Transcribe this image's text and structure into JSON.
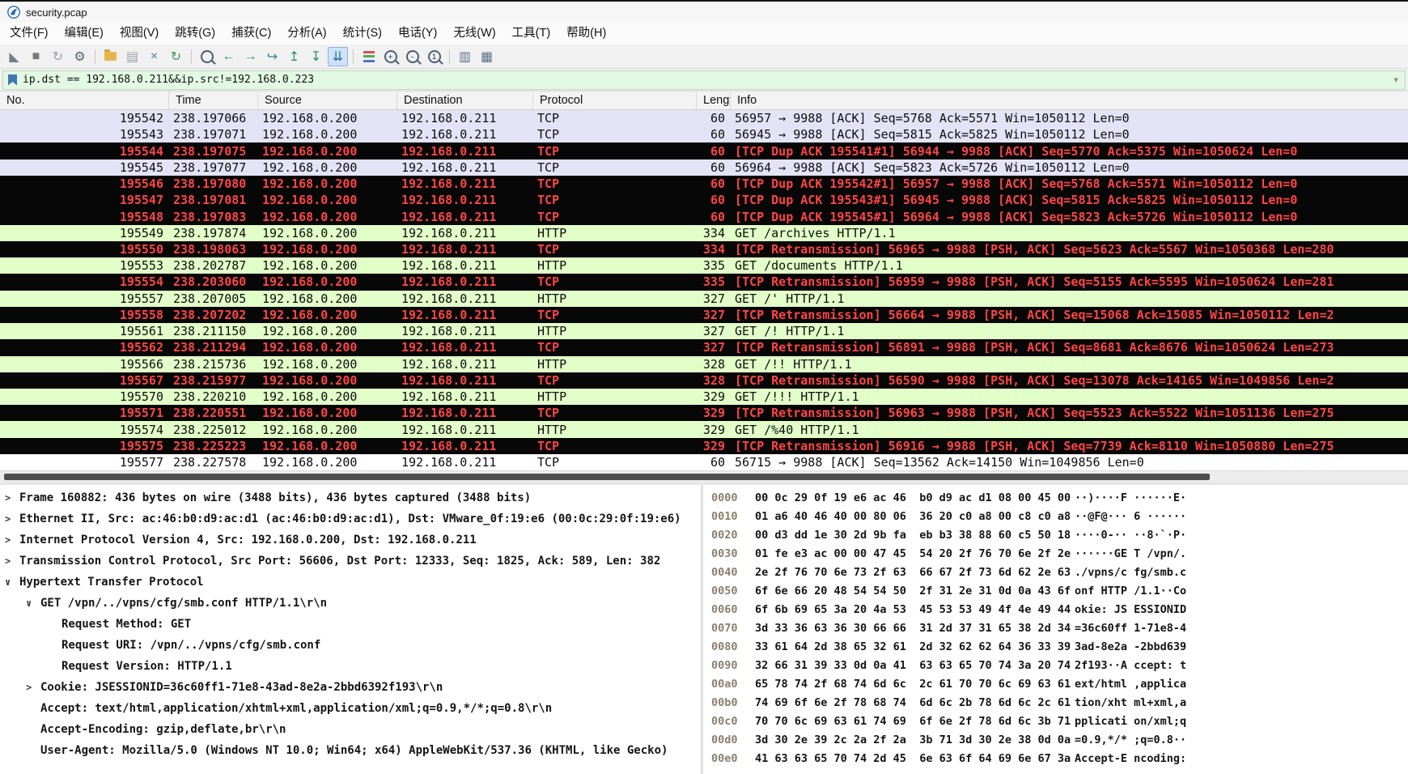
{
  "window": {
    "title": "security.pcap"
  },
  "menu": {
    "items": [
      {
        "id": "file",
        "label": "文件(F)"
      },
      {
        "id": "edit",
        "label": "编辑(E)"
      },
      {
        "id": "view",
        "label": "视图(V)"
      },
      {
        "id": "go",
        "label": "跳转(G)"
      },
      {
        "id": "capture",
        "label": "捕获(C)"
      },
      {
        "id": "analyze",
        "label": "分析(A)"
      },
      {
        "id": "statistics",
        "label": "统计(S)"
      },
      {
        "id": "telephony",
        "label": "电话(Y)"
      },
      {
        "id": "wireless",
        "label": "无线(W)"
      },
      {
        "id": "tools",
        "label": "工具(T)"
      },
      {
        "id": "help",
        "label": "帮助(H)"
      }
    ]
  },
  "toolbar": {
    "separators_after": [
      3,
      7,
      14,
      18
    ],
    "icons": [
      {
        "id": "start-capture",
        "kind": "glyph",
        "glyph": "◣",
        "color": "#6e7f8d"
      },
      {
        "id": "stop-capture",
        "kind": "glyph",
        "glyph": "■",
        "color": "#777777"
      },
      {
        "id": "restart-capture",
        "kind": "glyph",
        "glyph": "↻",
        "color": "#9aa0a6"
      },
      {
        "id": "capture-options",
        "kind": "glyph",
        "glyph": "⚙",
        "color": "#5a646e"
      },
      {
        "id": "open-file",
        "kind": "folder"
      },
      {
        "id": "save-file",
        "kind": "glyph",
        "glyph": "▤",
        "color": "#98a0a8"
      },
      {
        "id": "close-file",
        "kind": "glyph",
        "glyph": "×",
        "color": "#4e80b4"
      },
      {
        "id": "reload-file",
        "kind": "glyph",
        "glyph": "↻",
        "color": "#3f9b54"
      },
      {
        "id": "find-packet",
        "kind": "magnifier",
        "sub": ""
      },
      {
        "id": "go-back",
        "kind": "glyph",
        "glyph": "←",
        "color": "#2a8a7e"
      },
      {
        "id": "go-forward",
        "kind": "glyph",
        "glyph": "→",
        "color": "#2a8a7e"
      },
      {
        "id": "go-to-packet",
        "kind": "glyph",
        "glyph": "↪",
        "color": "#2a8a7e"
      },
      {
        "id": "go-top",
        "kind": "glyph",
        "glyph": "↥",
        "color": "#2a8a7e"
      },
      {
        "id": "go-bottom",
        "kind": "glyph",
        "glyph": "↧",
        "color": "#2a8a7e"
      },
      {
        "id": "auto-scroll",
        "kind": "glyph",
        "glyph": "⇊",
        "color": "#2f6ea8",
        "active": true
      },
      {
        "id": "colorize",
        "kind": "colorize"
      },
      {
        "id": "zoom-in",
        "kind": "magnifier",
        "sub": "+"
      },
      {
        "id": "zoom-out",
        "kind": "magnifier",
        "sub": "-"
      },
      {
        "id": "zoom-100",
        "kind": "magnifier",
        "sub": "1"
      },
      {
        "id": "resize-columns",
        "kind": "glyph",
        "glyph": "▥",
        "color": "#5a7089"
      },
      {
        "id": "adjust-columns",
        "kind": "glyph",
        "glyph": "▦",
        "color": "#5a7089"
      }
    ]
  },
  "filter": {
    "value": "ip.dst == 192.168.0.211&&ip.src!=192.168.0.223",
    "dropdown_icon": "▾"
  },
  "packet_list": {
    "columns": [
      "No.",
      "Time",
      "Source",
      "Destination",
      "Protocol",
      "Lengt",
      "Info"
    ],
    "rows": [
      {
        "no": "195542",
        "time": "238.197066",
        "src": "192.168.0.200",
        "dst": "192.168.0.211",
        "proto": "TCP",
        "len": "60",
        "info": "56957 → 9988 [ACK] Seq=5768 Ack=5571 Win=1050112 Len=0",
        "type": "tcp"
      },
      {
        "no": "195543",
        "time": "238.197071",
        "src": "192.168.0.200",
        "dst": "192.168.0.211",
        "proto": "TCP",
        "len": "60",
        "info": "56945 → 9988 [ACK] Seq=5815 Ack=5825 Win=1050112 Len=0",
        "type": "tcp"
      },
      {
        "no": "195544",
        "time": "238.197075",
        "src": "192.168.0.200",
        "dst": "192.168.0.211",
        "proto": "TCP",
        "len": "60",
        "info": "[TCP Dup ACK 195541#1] 56944 → 9988 [ACK] Seq=5770 Ack=5375 Win=1050624 Len=0",
        "type": "bad"
      },
      {
        "no": "195545",
        "time": "238.197077",
        "src": "192.168.0.200",
        "dst": "192.168.0.211",
        "proto": "TCP",
        "len": "60",
        "info": "56964 → 9988 [ACK] Seq=5823 Ack=5726 Win=1050112 Len=0",
        "type": "tcp"
      },
      {
        "no": "195546",
        "time": "238.197080",
        "src": "192.168.0.200",
        "dst": "192.168.0.211",
        "proto": "TCP",
        "len": "60",
        "info": "[TCP Dup ACK 195542#1] 56957 → 9988 [ACK] Seq=5768 Ack=5571 Win=1050112 Len=0",
        "type": "bad"
      },
      {
        "no": "195547",
        "time": "238.197081",
        "src": "192.168.0.200",
        "dst": "192.168.0.211",
        "proto": "TCP",
        "len": "60",
        "info": "[TCP Dup ACK 195543#1] 56945 → 9988 [ACK] Seq=5815 Ack=5825 Win=1050112 Len=0",
        "type": "bad"
      },
      {
        "no": "195548",
        "time": "238.197083",
        "src": "192.168.0.200",
        "dst": "192.168.0.211",
        "proto": "TCP",
        "len": "60",
        "info": "[TCP Dup ACK 195545#1] 56964 → 9988 [ACK] Seq=5823 Ack=5726 Win=1050112 Len=0",
        "type": "bad"
      },
      {
        "no": "195549",
        "time": "238.197874",
        "src": "192.168.0.200",
        "dst": "192.168.0.211",
        "proto": "HTTP",
        "len": "334",
        "info": "GET /archives HTTP/1.1",
        "type": "http"
      },
      {
        "no": "195550",
        "time": "238.198063",
        "src": "192.168.0.200",
        "dst": "192.168.0.211",
        "proto": "TCP",
        "len": "334",
        "info": "[TCP Retransmission] 56965 → 9988 [PSH, ACK] Seq=5623 Ack=5567 Win=1050368 Len=280",
        "type": "bad"
      },
      {
        "no": "195553",
        "time": "238.202787",
        "src": "192.168.0.200",
        "dst": "192.168.0.211",
        "proto": "HTTP",
        "len": "335",
        "info": "GET /documents HTTP/1.1",
        "type": "http"
      },
      {
        "no": "195554",
        "time": "238.203060",
        "src": "192.168.0.200",
        "dst": "192.168.0.211",
        "proto": "TCP",
        "len": "335",
        "info": "[TCP Retransmission] 56959 → 9988 [PSH, ACK] Seq=5155 Ack=5595 Win=1050624 Len=281",
        "type": "bad"
      },
      {
        "no": "195557",
        "time": "238.207005",
        "src": "192.168.0.200",
        "dst": "192.168.0.211",
        "proto": "HTTP",
        "len": "327",
        "info": "GET /' HTTP/1.1",
        "type": "http"
      },
      {
        "no": "195558",
        "time": "238.207202",
        "src": "192.168.0.200",
        "dst": "192.168.0.211",
        "proto": "TCP",
        "len": "327",
        "info": "[TCP Retransmission] 56664 → 9988 [PSH, ACK] Seq=15068 Ack=15085 Win=1050112 Len=2",
        "type": "bad"
      },
      {
        "no": "195561",
        "time": "238.211150",
        "src": "192.168.0.200",
        "dst": "192.168.0.211",
        "proto": "HTTP",
        "len": "327",
        "info": "GET /! HTTP/1.1",
        "type": "http"
      },
      {
        "no": "195562",
        "time": "238.211294",
        "src": "192.168.0.200",
        "dst": "192.168.0.211",
        "proto": "TCP",
        "len": "327",
        "info": "[TCP Retransmission] 56891 → 9988 [PSH, ACK] Seq=8681 Ack=8676 Win=1050624 Len=273",
        "type": "bad"
      },
      {
        "no": "195566",
        "time": "238.215736",
        "src": "192.168.0.200",
        "dst": "192.168.0.211",
        "proto": "HTTP",
        "len": "328",
        "info": "GET /!! HTTP/1.1",
        "type": "http"
      },
      {
        "no": "195567",
        "time": "238.215977",
        "src": "192.168.0.200",
        "dst": "192.168.0.211",
        "proto": "TCP",
        "len": "328",
        "info": "[TCP Retransmission] 56590 → 9988 [PSH, ACK] Seq=13078 Ack=14165 Win=1049856 Len=2",
        "type": "bad"
      },
      {
        "no": "195570",
        "time": "238.220210",
        "src": "192.168.0.200",
        "dst": "192.168.0.211",
        "proto": "HTTP",
        "len": "329",
        "info": "GET /!!! HTTP/1.1",
        "type": "http"
      },
      {
        "no": "195571",
        "time": "238.220551",
        "src": "192.168.0.200",
        "dst": "192.168.0.211",
        "proto": "TCP",
        "len": "329",
        "info": "[TCP Retransmission] 56963 → 9988 [PSH, ACK] Seq=5523 Ack=5522 Win=1051136 Len=275",
        "type": "bad"
      },
      {
        "no": "195574",
        "time": "238.225012",
        "src": "192.168.0.200",
        "dst": "192.168.0.211",
        "proto": "HTTP",
        "len": "329",
        "info": "GET /%40 HTTP/1.1",
        "type": "http"
      },
      {
        "no": "195575",
        "time": "238.225223",
        "src": "192.168.0.200",
        "dst": "192.168.0.211",
        "proto": "TCP",
        "len": "329",
        "info": "[TCP Retransmission] 56916 → 9988 [PSH, ACK] Seq=7739 Ack=8110 Win=1050880 Len=275",
        "type": "bad"
      },
      {
        "no": "195577",
        "time": "238.227578",
        "src": "192.168.0.200",
        "dst": "192.168.0.211",
        "proto": "TCP",
        "len": "60",
        "info": "56715 → 9988 [ACK] Seq=13562 Ack=14150 Win=1049856 Len=0",
        "type": "plain"
      }
    ]
  },
  "details": {
    "lines": [
      {
        "depth": 0,
        "expander": "collapsed",
        "text": "Frame 160882: 436 bytes on wire (3488 bits), 436 bytes captured (3488 bits)"
      },
      {
        "depth": 0,
        "expander": "collapsed",
        "text": "Ethernet II, Src: ac:46:b0:d9:ac:d1 (ac:46:b0:d9:ac:d1), Dst: VMware_0f:19:e6 (00:0c:29:0f:19:e6)"
      },
      {
        "depth": 0,
        "expander": "collapsed",
        "text": "Internet Protocol Version 4, Src: 192.168.0.200, Dst: 192.168.0.211"
      },
      {
        "depth": 0,
        "expander": "collapsed",
        "text": "Transmission Control Protocol, Src Port: 56606, Dst Port: 12333, Seq: 1825, Ack: 589, Len: 382"
      },
      {
        "depth": 0,
        "expander": "expanded",
        "text": "Hypertext Transfer Protocol"
      },
      {
        "depth": 1,
        "expander": "expanded",
        "text": "GET /vpn/../vpns/cfg/smb.conf HTTP/1.1\\r\\n"
      },
      {
        "depth": 2,
        "expander": "none",
        "text": "Request Method: GET"
      },
      {
        "depth": 2,
        "expander": "none",
        "text": "Request URI: /vpn/../vpns/cfg/smb.conf"
      },
      {
        "depth": 2,
        "expander": "none",
        "text": "Request Version: HTTP/1.1"
      },
      {
        "depth": 1,
        "expander": "collapsed",
        "text": "Cookie: JSESSIONID=36c60ff1-71e8-43ad-8e2a-2bbd6392f193\\r\\n"
      },
      {
        "depth": 1,
        "expander": "none",
        "text": "Accept: text/html,application/xhtml+xml,application/xml;q=0.9,*/*;q=0.8\\r\\n"
      },
      {
        "depth": 1,
        "expander": "none",
        "text": "Accept-Encoding: gzip,deflate,br\\r\\n"
      },
      {
        "depth": 1,
        "expander": "none",
        "text": "User-Agent: Mozilla/5.0 (Windows NT 10.0; Win64; x64) AppleWebKit/537.36 (KHTML, like Gecko)"
      }
    ]
  },
  "hex": {
    "rows": [
      {
        "offset": "0000",
        "hex": "00 0c 29 0f 19 e6 ac 46  b0 d9 ac d1 08 00 45 00",
        "ascii": "··)····F ······E·"
      },
      {
        "offset": "0010",
        "hex": "01 a6 40 46 40 00 80 06  36 20 c0 a8 00 c8 c0 a8",
        "ascii": "··@F@··· 6 ······"
      },
      {
        "offset": "0020",
        "hex": "00 d3 dd 1e 30 2d 9b fa  eb b3 38 88 60 c5 50 18",
        "ascii": "····0-·· ··8·`·P·"
      },
      {
        "offset": "0030",
        "hex": "01 fe e3 ac 00 00 47 45  54 20 2f 76 70 6e 2f 2e",
        "ascii": "······GE T /vpn/."
      },
      {
        "offset": "0040",
        "hex": "2e 2f 76 70 6e 73 2f 63  66 67 2f 73 6d 62 2e 63",
        "ascii": "./vpns/c fg/smb.c"
      },
      {
        "offset": "0050",
        "hex": "6f 6e 66 20 48 54 54 50  2f 31 2e 31 0d 0a 43 6f",
        "ascii": "onf HTTP /1.1··Co"
      },
      {
        "offset": "0060",
        "hex": "6f 6b 69 65 3a 20 4a 53  45 53 53 49 4f 4e 49 44",
        "ascii": "okie: JS ESSIONID"
      },
      {
        "offset": "0070",
        "hex": "3d 33 36 63 36 30 66 66  31 2d 37 31 65 38 2d 34",
        "ascii": "=36c60ff 1-71e8-4"
      },
      {
        "offset": "0080",
        "hex": "33 61 64 2d 38 65 32 61  2d 32 62 62 64 36 33 39",
        "ascii": "3ad-8e2a -2bbd639"
      },
      {
        "offset": "0090",
        "hex": "32 66 31 39 33 0d 0a 41  63 63 65 70 74 3a 20 74",
        "ascii": "2f193··A ccept: t"
      },
      {
        "offset": "00a0",
        "hex": "65 78 74 2f 68 74 6d 6c  2c 61 70 70 6c 69 63 61",
        "ascii": "ext/html ,applica"
      },
      {
        "offset": "00b0",
        "hex": "74 69 6f 6e 2f 78 68 74  6d 6c 2b 78 6d 6c 2c 61",
        "ascii": "tion/xht ml+xml,a"
      },
      {
        "offset": "00c0",
        "hex": "70 70 6c 69 63 61 74 69  6f 6e 2f 78 6d 6c 3b 71",
        "ascii": "pplicati on/xml;q"
      },
      {
        "offset": "00d0",
        "hex": "3d 30 2e 39 2c 2a 2f 2a  3b 71 3d 30 2e 38 0d 0a",
        "ascii": "=0.9,*/* ;q=0.8··"
      },
      {
        "offset": "00e0",
        "hex": "41 63 63 65 70 74 2d 45  6e 63 6f 64 69 6e 67 3a",
        "ascii": "Accept-E ncoding:"
      }
    ]
  },
  "colors": {
    "bad_tcp_bg": "#070707",
    "bad_tcp_fg": "#ff4545",
    "tcp_row_bg": "#e4e3f6",
    "http_row_bg": "#e3ffc9",
    "filter_valid_bg": "#e4f9e4",
    "autoscroll_active_bg": "#cde2f6",
    "logo_blue": "#2b6fae"
  }
}
